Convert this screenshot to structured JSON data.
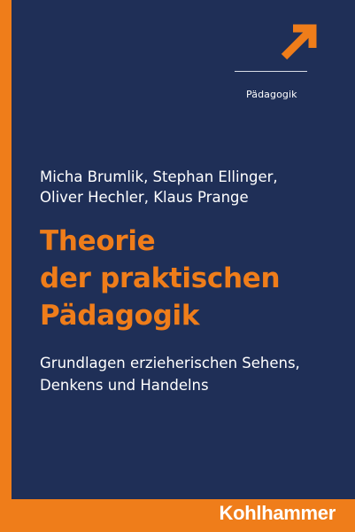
{
  "series": {
    "label": "Pädagogik",
    "icon": "arrow-up-right-icon"
  },
  "authors": [
    "Micha Brumlik, Stephan Ellinger,",
    "Oliver Hechler, Klaus Prange"
  ],
  "title": [
    "Theorie",
    "der praktischen",
    "Pädagogik"
  ],
  "subtitle": [
    "Grundlagen erzieherischen Sehens,",
    "Denkens und Handelns"
  ],
  "publisher": "Kohlhammer",
  "colors": {
    "background": "#1f2f57",
    "accent": "#ef7d1a",
    "text": "#ffffff"
  }
}
